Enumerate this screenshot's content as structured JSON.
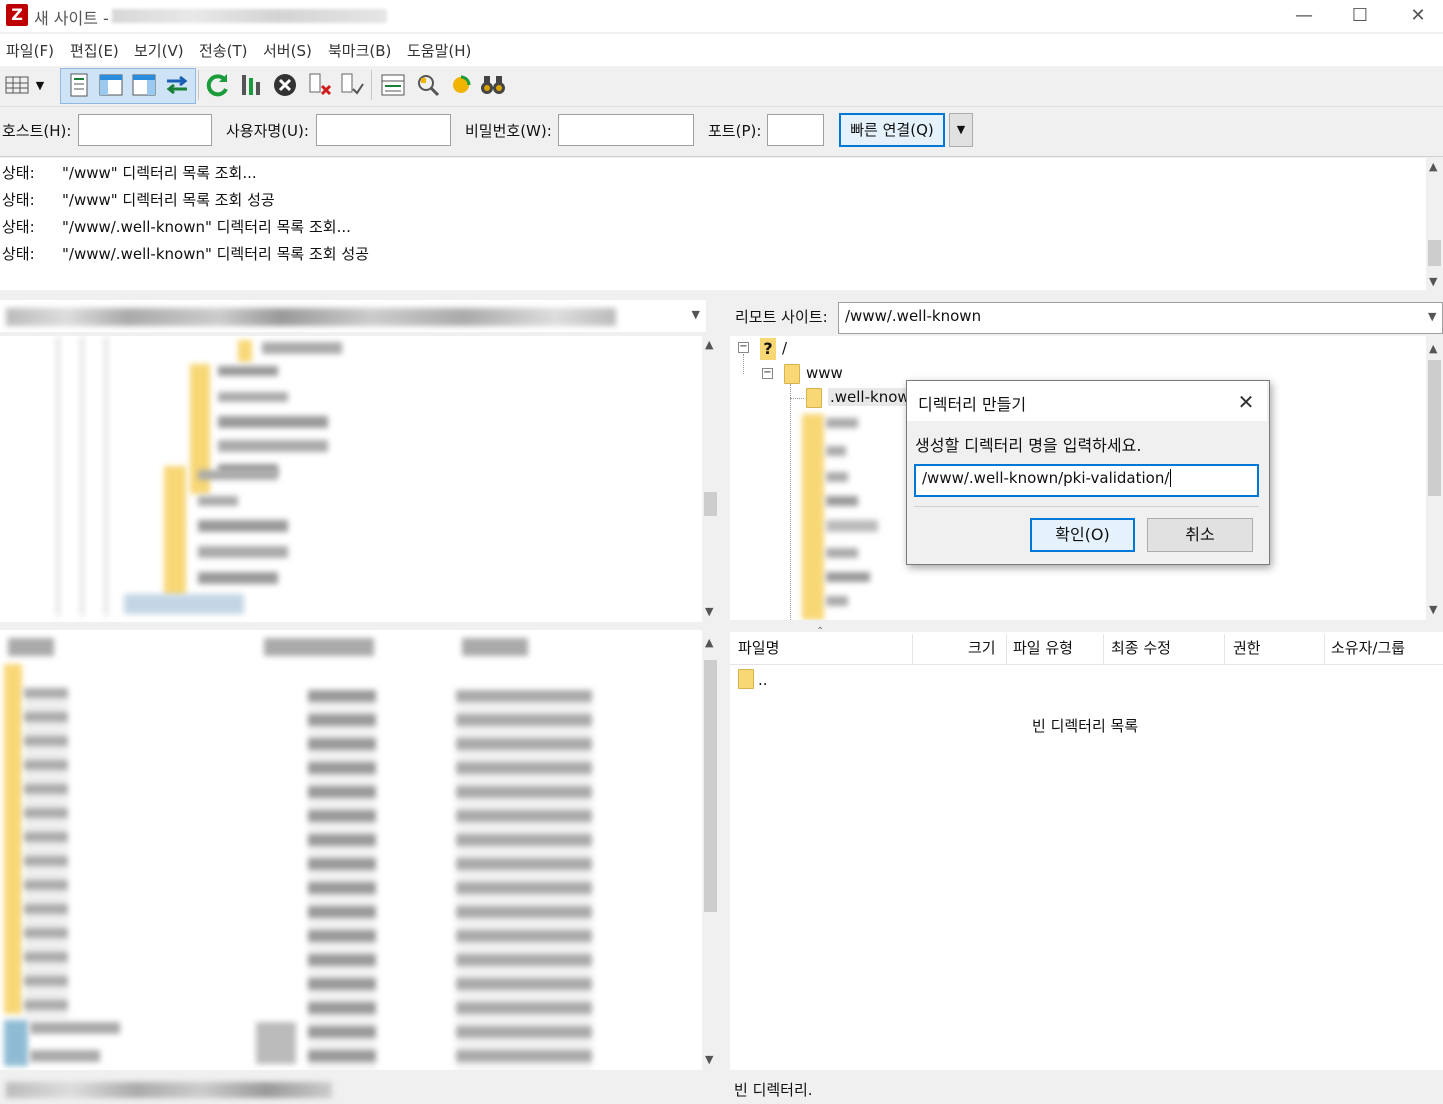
{
  "window": {
    "app_icon": "Z",
    "title": "새 사이트 -",
    "minimize": "—",
    "maximize": "☐",
    "close": "✕"
  },
  "menu": [
    {
      "label": "파일(F)"
    },
    {
      "label": "편집(E)"
    },
    {
      "label": "보기(V)"
    },
    {
      "label": "전송(T)"
    },
    {
      "label": "서버(S)"
    },
    {
      "label": "북마크(B)"
    },
    {
      "label": "도움말(H)"
    }
  ],
  "quickconnect": {
    "host_label": "호스트(H):",
    "user_label": "사용자명(U):",
    "pass_label": "비밀번호(W):",
    "port_label": "포트(P):",
    "connect_label": "빠른 연결(Q)",
    "host_value": "",
    "user_value": "",
    "pass_value": "",
    "port_value": ""
  },
  "log": [
    {
      "label": "상태:",
      "message": "\"/www\" 디렉터리 목록 조회..."
    },
    {
      "label": "상태:",
      "message": "\"/www\" 디렉터리 목록 조회 성공"
    },
    {
      "label": "상태:",
      "message": "\"/www/.well-known\" 디렉터리 목록 조회..."
    },
    {
      "label": "상태:",
      "message": "\"/www/.well-known\" 디렉터리 목록 조회 성공"
    }
  ],
  "remote": {
    "site_label": "리모트 사이트:",
    "site_path": "/www/.well-known",
    "tree": {
      "root": "/",
      "www": "www",
      "well_known": ".well-known"
    },
    "columns": {
      "filename": "파일명",
      "size": "크기",
      "type": "파일 유형",
      "modified": "최종 수정",
      "perms": "권한",
      "owner": "소유자/그룹"
    },
    "parent_entry": "..",
    "empty_message": "빈 디렉터리 목록",
    "status": "빈 디렉터리."
  },
  "dialog": {
    "title": "디렉터리 만들기",
    "prompt": "생성할 디렉터리 명을 입력하세요.",
    "input_value": "/www/.well-known/pki-validation/",
    "ok_label": "확인(O)",
    "cancel_label": "취소"
  }
}
